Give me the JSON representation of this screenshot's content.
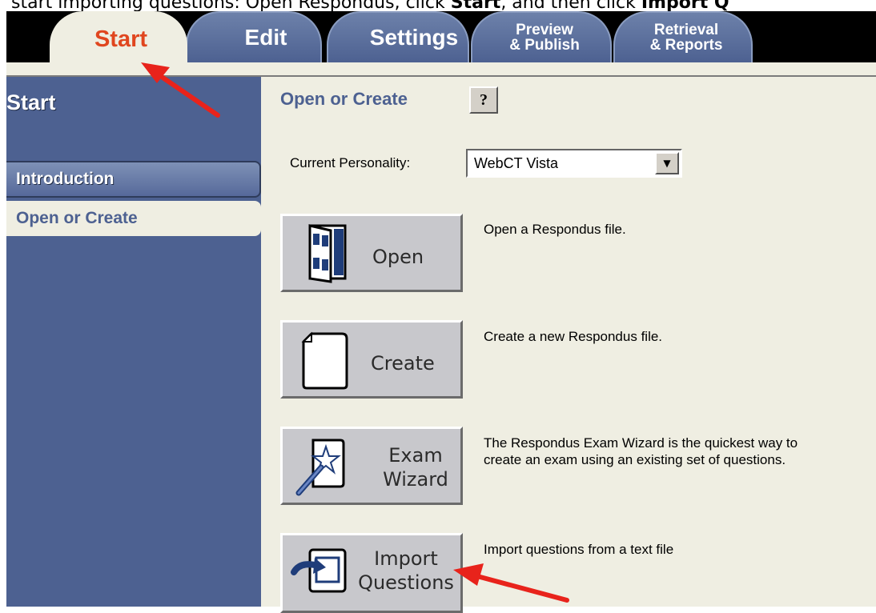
{
  "caption": {
    "prefix": "start importing questions: Open Respondus, click ",
    "start": "Start",
    "middle": ", and then click ",
    "import": "Import Q"
  },
  "tabs": {
    "start": "Start",
    "edit": "Edit",
    "settings": "Settings",
    "preview_line1": "Preview",
    "preview_line2": "& Publish",
    "retrieval_line1": "Retrieval",
    "retrieval_line2": "& Reports"
  },
  "sidebar": {
    "title": "Start",
    "items": [
      {
        "label": "Introduction"
      },
      {
        "label": "Open or Create"
      }
    ]
  },
  "main": {
    "section_title": "Open or Create",
    "help_label": "?",
    "personality_label": "Current Personality:",
    "personality_value": "WebCT  Vista",
    "buttons": [
      {
        "label": "Open",
        "desc_line1": "Open a Respondus file.",
        "desc_line2": ""
      },
      {
        "label": "Create",
        "desc_line1": "Create a new Respondus file.",
        "desc_line2": ""
      },
      {
        "label_line1": "Exam",
        "label_line2": "Wizard",
        "desc_line1": "The Respondus Exam Wizard is the quickest way to",
        "desc_line2": "create an exam using an existing set of questions."
      },
      {
        "label_line1": "Import",
        "label_line2": "Questions",
        "desc_line1": "Import questions from a text file",
        "desc_line2": ""
      }
    ]
  },
  "colors": {
    "sidebar_blue": "#4d6191",
    "panel_cream": "#efeee2",
    "active_tab_text": "#e0461f",
    "annotation_arrow": "#e8231b"
  }
}
